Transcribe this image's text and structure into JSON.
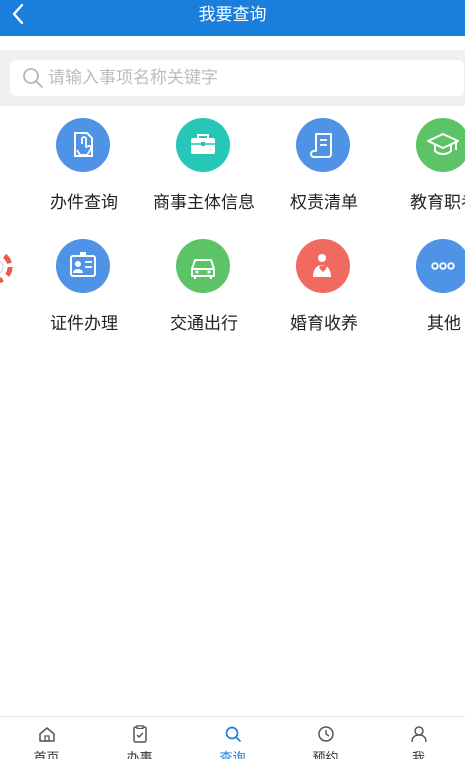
{
  "header": {
    "title": "我要查询"
  },
  "search": {
    "placeholder": "请输入事项名称关键字"
  },
  "grid": [
    {
      "label": "办件查询",
      "icon": "hand-document-icon",
      "color": "#4f93e6"
    },
    {
      "label": "商事主体信息",
      "icon": "briefcase-icon",
      "color": "#27c7b8"
    },
    {
      "label": "权责清单",
      "icon": "scroll-icon",
      "color": "#4f93e6"
    },
    {
      "label": "教育职考",
      "icon": "graduation-cap-icon",
      "color": "#5cc466"
    },
    {
      "label": "证件办理",
      "icon": "id-card-icon",
      "color": "#4f93e6"
    },
    {
      "label": "交通出行",
      "icon": "car-icon",
      "color": "#5cc466"
    },
    {
      "label": "婚育收养",
      "icon": "mother-child-icon",
      "color": "#f06a5f"
    },
    {
      "label": "其他",
      "icon": "more-dots-icon",
      "color": "#4f93e6"
    }
  ],
  "tabbar": [
    {
      "label": "首页",
      "icon": "home-icon",
      "active": false
    },
    {
      "label": "办事",
      "icon": "clipboard-icon",
      "active": false
    },
    {
      "label": "查询",
      "icon": "search-icon",
      "active": true
    },
    {
      "label": "预约",
      "icon": "clock-icon",
      "active": false
    },
    {
      "label": "我",
      "icon": "person-icon",
      "active": false
    }
  ],
  "colors": {
    "header": "#1a7fdc",
    "accent": "#1a7fdc"
  }
}
